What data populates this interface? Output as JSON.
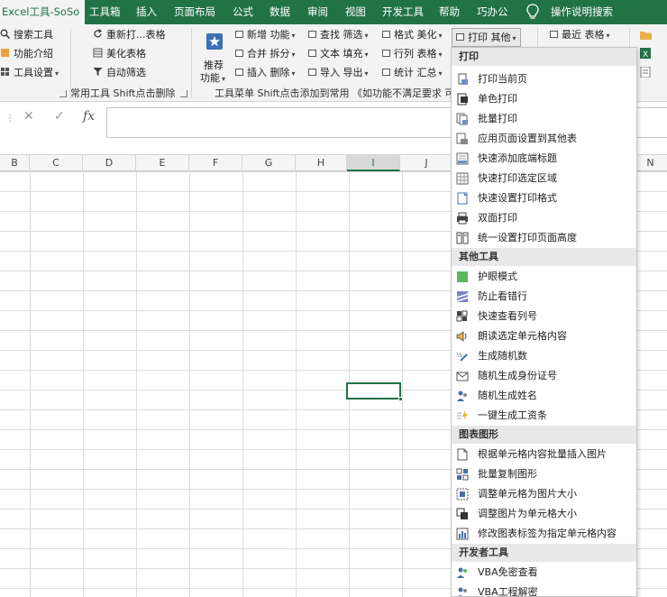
{
  "tabs": [
    "Excel工具-SoSo",
    "工具箱",
    "插入",
    "页面布局",
    "公式",
    "数据",
    "审阅",
    "视图",
    "开发工具",
    "帮助",
    "巧办公",
    "操作说明搜索"
  ],
  "ribbon": {
    "group1": {
      "search_tools": "搜索工具",
      "feature_intro": "功能介绍",
      "tool_settings": "工具设置",
      "label": "常用工具 Shift点击删除"
    },
    "group2": {
      "reopen": "重新打...表格",
      "beautify": "美化表格",
      "auto_filter": "自动筛选"
    },
    "recommend": {
      "line1": "推荐",
      "line2": "功能"
    },
    "col_a": [
      "新增 功能",
      "合并 拆分",
      "插入 删除"
    ],
    "col_b": [
      "查找 筛选",
      "文本 填充",
      "导入 导出"
    ],
    "col_c": [
      "格式 美化",
      "行列 表格",
      "统计 汇总"
    ],
    "col_d": [
      "打印 其他",
      "最近 表格"
    ],
    "tools_label": "工具菜单 Shift点击添加到常用 《如功能不满足要求 可"
  },
  "formula_bar": {
    "fx": "fx",
    "dots": "⋮",
    "cancel": "✕",
    "enter": "✓"
  },
  "columns": [
    "B",
    "C",
    "D",
    "E",
    "F",
    "G",
    "H",
    "I",
    "J",
    "N"
  ],
  "menu": {
    "sections": [
      {
        "title": "打印",
        "items": [
          "打印当前页",
          "单色打印",
          "批量打印",
          "应用页面设置到其他表",
          "快速添加底端标题",
          "快速打印选定区域",
          "快速设置打印格式",
          "双面打印",
          "统一设置打印页面高度"
        ]
      },
      {
        "title": "其他工具",
        "items": [
          "护眼模式",
          "防止看错行",
          "快速查看列号",
          "朗读选定单元格内容",
          "生成随机数",
          "随机生成身份证号",
          "随机生成姓名",
          "一键生成工资条"
        ]
      },
      {
        "title": "图表图形",
        "items": [
          "根据单元格内容批量插入图片",
          "批量复制图形",
          "调整单元格为图片大小",
          "调整图片为单元格大小",
          "修改图表标签为指定单元格内容"
        ]
      },
      {
        "title": "开发者工具",
        "items": [
          "VBA免密查看",
          "VBA工程解密"
        ]
      }
    ]
  },
  "colors": {
    "excel_green": "#217346",
    "ribbon_bg": "#f3f3f3",
    "header_bg": "#e8e8e8"
  }
}
